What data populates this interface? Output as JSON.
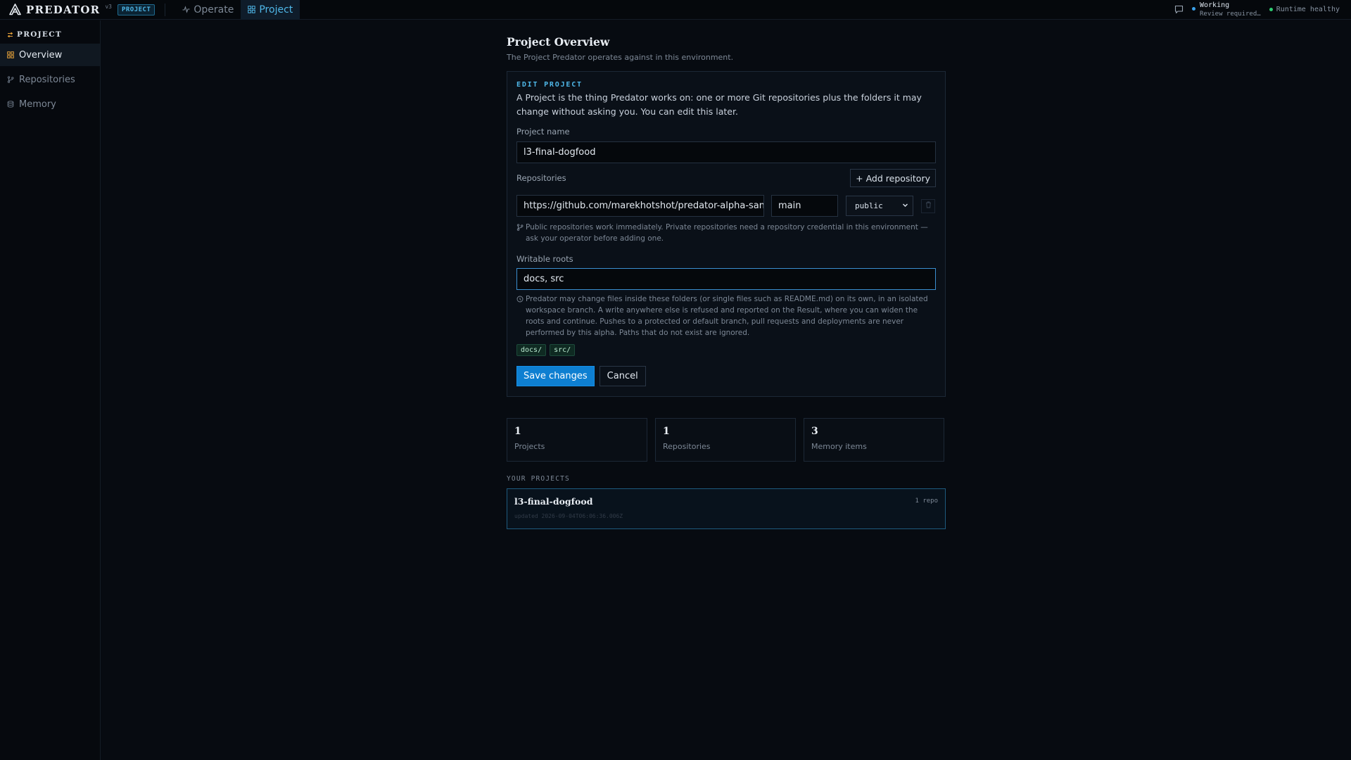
{
  "topbar": {
    "brand_name": "PREDATOR",
    "brand_version": "v3",
    "brand_badge": "PROJECT",
    "tabs": [
      {
        "label": "Operate",
        "icon": "activity-icon",
        "active": false
      },
      {
        "label": "Project",
        "icon": "grid-icon",
        "active": true
      }
    ],
    "status": {
      "title": "Working",
      "subtitle": "Review required…"
    },
    "runtime": "Runtime healthy"
  },
  "sidebar": {
    "heading": "PROJECT",
    "items": [
      {
        "label": "Overview",
        "icon": "grid-icon",
        "active": true
      },
      {
        "label": "Repositories",
        "icon": "git-branch-icon",
        "active": false
      },
      {
        "label": "Memory",
        "icon": "database-icon",
        "active": false
      }
    ]
  },
  "page": {
    "title": "Project Overview",
    "subtitle": "The Project Predator operates against in this environment."
  },
  "edit": {
    "kicker": "EDIT PROJECT",
    "intro": "A Project is the thing Predator works on: one or more Git repositories plus the folders it may change without asking you. You can edit this later.",
    "name_label": "Project name",
    "name_value": "l3-final-dogfood",
    "repos_label": "Repositories",
    "add_repo": "+ Add repository",
    "repo_url": "https://github.com/marekhotshot/predator-alpha-sanc",
    "repo_branch": "main",
    "repo_visibility": "public",
    "repo_hint": "Public repositories work immediately. Private repositories need a repository credential in this environment — ask your operator before adding one.",
    "roots_label": "Writable roots",
    "roots_value": "docs, src",
    "roots_hint": "Predator may change files inside these folders (or single files such as README.md) on its own, in an isolated workspace branch. A write anywhere else is refused and reported on the Result, where you can widen the roots and continue. Pushes to a protected or default branch, pull requests and deployments are never performed by this alpha. Paths that do not exist are ignored.",
    "chips": [
      "docs/",
      "src/"
    ],
    "save": "Save changes",
    "cancel": "Cancel"
  },
  "stats": [
    {
      "value": "1",
      "label": "Projects"
    },
    {
      "value": "1",
      "label": "Repositories"
    },
    {
      "value": "3",
      "label": "Memory items"
    }
  ],
  "projects": {
    "section_label": "YOUR PROJECTS",
    "items": [
      {
        "name": "l3-final-dogfood",
        "updated": "updated 2026-09-04T06:06:36.006Z",
        "count": "1 repo"
      }
    ]
  },
  "colors": {
    "accent": "#4fb7e8",
    "primary_button": "#0e7fd1",
    "healthy": "#2ecc71",
    "working": "#3aa0e8",
    "background": "#070b11"
  }
}
